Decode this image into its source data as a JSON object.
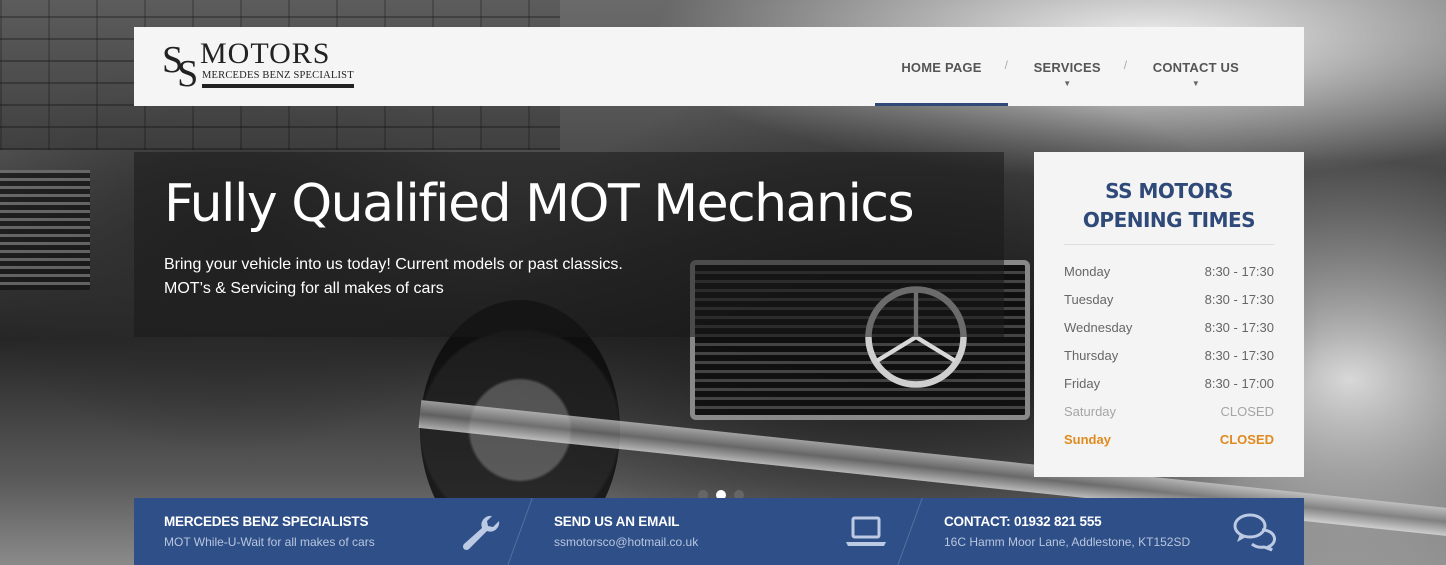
{
  "header": {
    "logo": {
      "mark": "SS",
      "name": "MOTORS",
      "tagline": "MERCEDES BENZ SPECIALIST"
    },
    "nav": [
      {
        "label": "HOME PAGE",
        "active": true,
        "has_submenu": false
      },
      {
        "label": "SERVICES",
        "active": false,
        "has_submenu": true
      },
      {
        "label": "CONTACT US",
        "active": false,
        "has_submenu": true
      }
    ],
    "separator": "/",
    "caret": "▼"
  },
  "hero": {
    "title": "Fully Qualified MOT Mechanics",
    "line1": "Bring your vehicle into us today! Current models or past classics.",
    "line2": "MOT’s & Servicing for all makes of cars",
    "slides": 3,
    "active_slide": 2
  },
  "opening_times": {
    "title": "SS MOTORS OPENING TIMES",
    "rows": [
      {
        "day": "Monday",
        "hours": "8:30 - 17:30",
        "style": "normal"
      },
      {
        "day": "Tuesday",
        "hours": "8:30 - 17:30",
        "style": "normal"
      },
      {
        "day": "Wednesday",
        "hours": "8:30 - 17:30",
        "style": "normal"
      },
      {
        "day": "Thursday",
        "hours": "8:30 - 17:30",
        "style": "normal"
      },
      {
        "day": "Friday",
        "hours": "8:30 - 17:00",
        "style": "normal"
      },
      {
        "day": "Saturday",
        "hours": "CLOSED",
        "style": "muted"
      },
      {
        "day": "Sunday",
        "hours": "CLOSED",
        "style": "highlight"
      }
    ]
  },
  "info_bar": [
    {
      "title": "MERCEDES BENZ SPECIALISTS",
      "subtitle": "MOT While-U-Wait for all makes of cars",
      "icon": "wrench-icon"
    },
    {
      "title": "SEND US AN EMAIL",
      "subtitle": "ssmotorsco@hotmail.co.uk",
      "icon": "laptop-icon"
    },
    {
      "title": "CONTACT: 01932 821 555",
      "subtitle": "16C Hamm Moor Lane, Addlestone, KT152SD",
      "icon": "chat-bubbles-icon"
    }
  ],
  "colors": {
    "brand_blue": "#2f4a78",
    "info_bar": "#2f4f88",
    "accent_orange": "#e08a1e"
  }
}
